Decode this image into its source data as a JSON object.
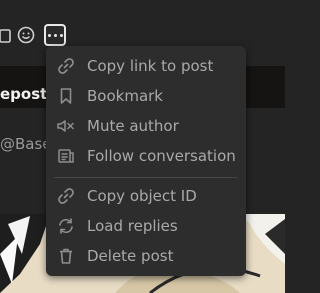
{
  "post": {
    "repost_text": "epost",
    "handle_text": "@Base"
  },
  "toolbar": {
    "icons": [
      "clipboard-icon",
      "emoji-icon",
      "more-icon"
    ]
  },
  "menu": {
    "items": [
      {
        "label": "Copy link to post",
        "icon": "link-icon"
      },
      {
        "label": "Bookmark",
        "icon": "bookmark-icon"
      },
      {
        "label": "Mute author",
        "icon": "mute-icon"
      },
      {
        "label": "Follow conversation",
        "icon": "follow-conversation-icon"
      },
      {
        "label": "Copy object ID",
        "icon": "link-icon"
      },
      {
        "label": "Load replies",
        "icon": "refresh-icon"
      },
      {
        "label": "Delete post",
        "icon": "trash-icon"
      }
    ]
  },
  "colors": {
    "background": "#242424",
    "menu_background": "#2d2d2d",
    "menu_text": "#a9a9a9",
    "post_text": "#f2f2f2",
    "handle_text": "#9a9a9a"
  }
}
